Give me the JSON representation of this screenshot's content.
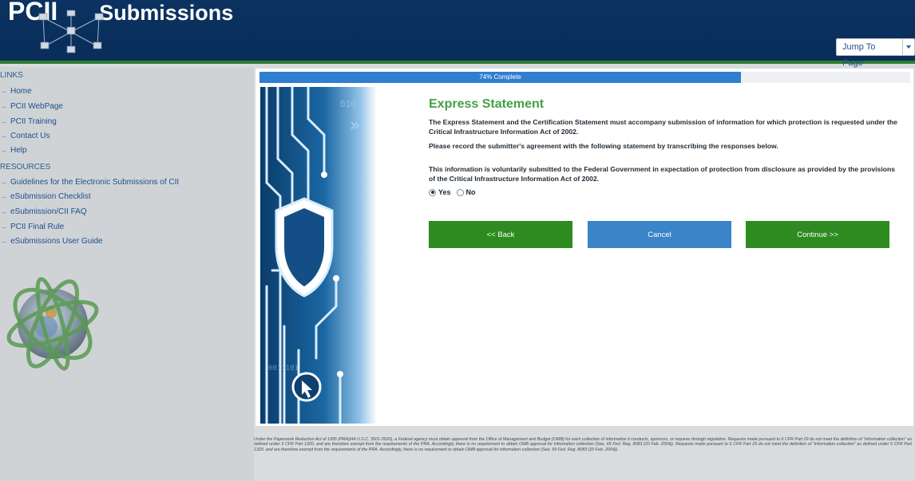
{
  "header": {
    "logo_text_left": "PCII",
    "logo_text_right": "Submissions",
    "jump_label": "Jump To Page"
  },
  "sidebar": {
    "links_heading": "LINKS",
    "links": [
      "Home",
      "PCII WebPage",
      "PCII Training",
      "Contact Us",
      "Help"
    ],
    "resources_heading": "RESOURCES",
    "resources": [
      "Guidelines for the Electronic Submissions of CII",
      "eSubmission Checklist",
      "eSubmission/CII FAQ",
      "PCII Final Rule",
      "eSubmissions User Guide"
    ]
  },
  "progress": {
    "label": "74% Complete",
    "percent": 74
  },
  "main": {
    "title": "Express Statement",
    "intro": "The Express Statement and the Certification Statement must accompany submission of information for which protection is requested under the Critical Infrastructure Information Act of 2002.",
    "instruction": "Please record the submitter's agreement with the following statement by transcribing the responses below.",
    "statement": "This information is voluntarily submitted to the Federal Government in expectation of protection from disclosure as provided by the provisions of the Critical Infrastructure Information Act of 2002.",
    "yes_label": "Yes",
    "no_label": "No",
    "selected": "Yes"
  },
  "buttons": {
    "back": "<< Back",
    "cancel": "Cancel",
    "continue": "Continue >>"
  },
  "footer": {
    "text": "Under the Paperwork Reduction Act of 1995 (PRA)(44 U.S.C. 3501-3520), a Federal agency must obtain approval from the Office of Management and Budget (OMB) for each collection of information it conducts, sponsors, or requires through regulation. Requests made pursuant to 6 CFR Part 29 do not meet the definition of \"information collection\" as defined under 5 CFR Part 1320, and are therefore exempt from the requirements of the PRA. Accordingly, there is no requirement to obtain OMB approval for information collection (See, 69 Fed. Reg. 8083 (20 Feb. 2004)). Requests made pursuant to 6 CFR Part 29 do not meet the definition of \"information collection\" as defined under 5 CFR Part 1320, and are therefore exempt from the requirements of the PRA. Accordingly, there is no requirement to obtain OMB approval for information collection (See, 69 Fed. Reg. 8083 (20 Feb. 2004))."
  },
  "colors": {
    "header": "#0b3260",
    "accent_green": "#2e8b20",
    "title_green": "#44a047",
    "progress_blue": "#2f7ed0",
    "cancel_blue": "#3a84c7"
  }
}
